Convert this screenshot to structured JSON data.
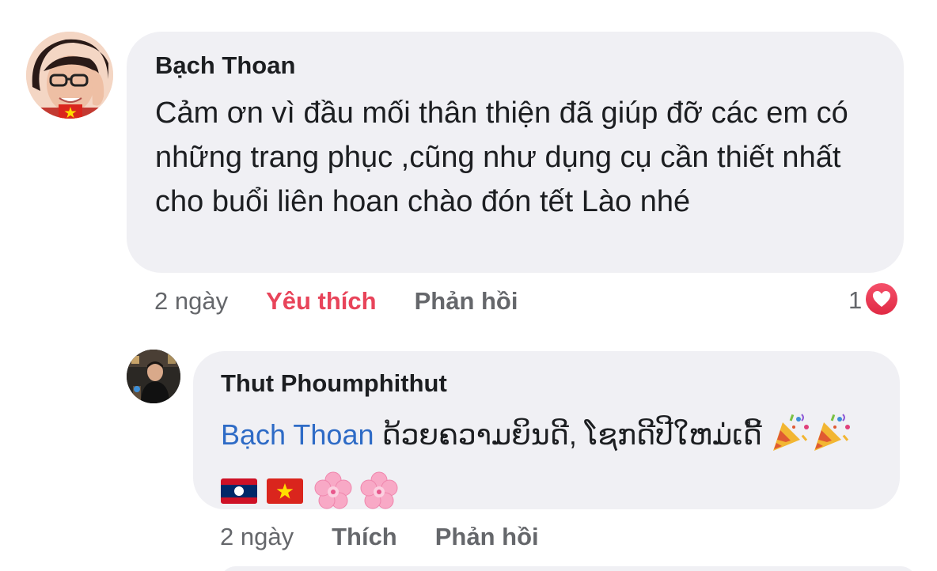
{
  "comment": {
    "author": "Bạch Thoan",
    "body": "Cảm ơn vì đầu mối thân thiện đã giúp đỡ các em có những trang phục ,cũng như dụng cụ cần thiết nhất cho buổi liên hoan chào đón tết Lào nhé",
    "time": "2 ngày",
    "like_label": "Yêu thích",
    "reply_label": "Phản hồi",
    "reaction_count": "1",
    "reaction_icon": "heart-icon",
    "like_active_color": "#e8445a",
    "avatar_flag": "vietnam-flag"
  },
  "reply": {
    "author": "Thut Phoumphithut",
    "mention": "Bạch Thoan",
    "text": " ດ້ວຍຄວາມຍິນດີ, ໂຊກດີປີໃຫມ່ເດີ້",
    "emojis_line1": [
      "party-popper-icon",
      "party-popper-icon"
    ],
    "emojis_line2": [
      "laos-flag-icon",
      "vietnam-flag-icon",
      "cherry-blossom-icon",
      "cherry-blossom-icon"
    ],
    "time": "2 ngày",
    "like_label": "Thích",
    "reply_label": "Phản hồi",
    "mention_color": "#2e6bc6"
  }
}
